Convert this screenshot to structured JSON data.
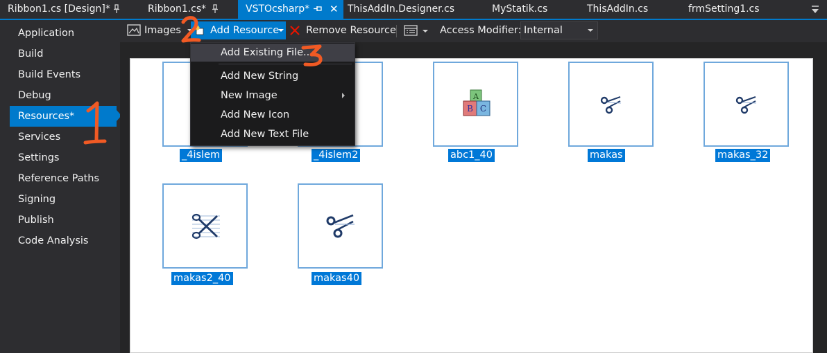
{
  "tabs": [
    {
      "label": "Ribbon1.cs [Design]*",
      "pinned": true
    },
    {
      "label": "Ribbon1.cs*",
      "pinned": true
    },
    {
      "label": "VSTOcsharp*",
      "active": true
    },
    {
      "label": "ThisAddIn.Designer.cs"
    },
    {
      "label": "MyStatik.cs"
    },
    {
      "label": "ThisAddIn.cs"
    },
    {
      "label": "frmSetting1.cs"
    }
  ],
  "sidebar": {
    "items": [
      {
        "label": "Application"
      },
      {
        "label": "Build"
      },
      {
        "label": "Build Events"
      },
      {
        "label": "Debug"
      },
      {
        "label": "Resources*",
        "active": true
      },
      {
        "label": "Services"
      },
      {
        "label": "Settings"
      },
      {
        "label": "Reference Paths"
      },
      {
        "label": "Signing"
      },
      {
        "label": "Publish"
      },
      {
        "label": "Code Analysis"
      }
    ]
  },
  "toolbar": {
    "images_label": "Images",
    "add_resource_label": "Add Resource",
    "remove_resource_label": "Remove Resource",
    "access_modifier_label": "Access Modifier:",
    "access_modifier_value": "Internal"
  },
  "add_resource_menu": {
    "items": [
      {
        "label": "Add Existing File...",
        "highlighted": true
      },
      {
        "label": "Add New String"
      },
      {
        "label": "New Image",
        "has_submenu": true
      },
      {
        "label": "Add New Icon"
      },
      {
        "label": "Add New Text File"
      }
    ]
  },
  "resources": [
    {
      "name": "_4islem",
      "icon": "hidden-under-menu"
    },
    {
      "name": "_4islem2",
      "icon": "hidden-under-menu"
    },
    {
      "name": "abc1_40",
      "icon": "abc-blocks-icon"
    },
    {
      "name": "makas",
      "icon": "scissors-icon"
    },
    {
      "name": "makas_32",
      "icon": "scissors-icon"
    },
    {
      "name": "makas2_40",
      "icon": "scissors-sketch-icon"
    },
    {
      "name": "makas40",
      "icon": "scissors-icon"
    }
  ],
  "annotations": [
    "1",
    "2",
    "3"
  ],
  "colors": {
    "accent": "#007acc",
    "annotation": "#f15a24",
    "tile_border": "#6fa8dc",
    "caption_bg": "#0078d7"
  }
}
